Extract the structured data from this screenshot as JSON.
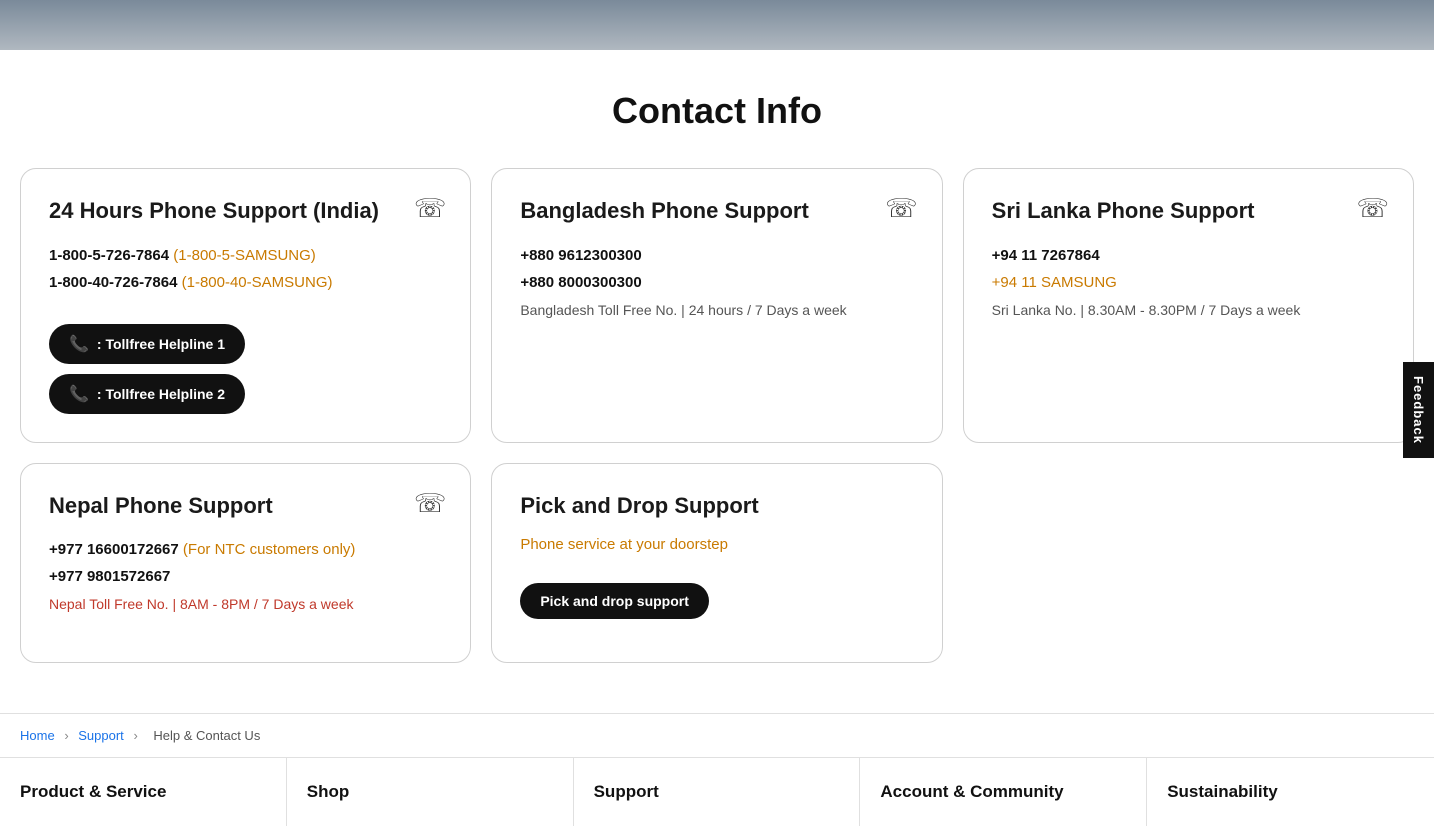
{
  "hero": {},
  "page": {
    "title": "Contact Info"
  },
  "cards_row1": [
    {
      "id": "india",
      "title": "24 Hours Phone Support (India)",
      "phone1": "1-800-5-726-7864",
      "phone1_alt": "(1-800-5-SAMSUNG)",
      "phone2": "1-800-40-726-7864",
      "phone2_alt": "(1-800-40-SAMSUNG)",
      "btn1": "📞 : Tollfree Helpline 1",
      "btn2": "📞 : Tollfree Helpline 2"
    },
    {
      "id": "bangladesh",
      "title": "Bangladesh Phone Support",
      "phone1": "+880 9612300300",
      "phone2": "+880 8000300300",
      "note": "Bangladesh Toll Free No. | 24 hours / 7 Days a week"
    },
    {
      "id": "srilanka",
      "title": "Sri Lanka Phone Support",
      "phone1": "+94 11 7267864",
      "phone2_alt": "+94 11 SAMSUNG",
      "note": "Sri Lanka No. | 8.30AM - 8.30PM / 7 Days a week"
    }
  ],
  "cards_row2": [
    {
      "id": "nepal",
      "title": "Nepal Phone Support",
      "phone1": "+977 16600172667",
      "phone1_alt": "(For NTC customers only)",
      "phone2": "+977 9801572667",
      "note": "Nepal Toll Free No. | 8AM - 8PM / 7 Days a week"
    },
    {
      "id": "pickdrop",
      "title": "Pick and Drop Support",
      "subtitle": "Phone service at your doorstep",
      "btn": "Pick and drop support"
    }
  ],
  "breadcrumb": {
    "home": "Home",
    "support": "Support",
    "current": "Help & Contact Us"
  },
  "footer": {
    "cols": [
      {
        "id": "product-service",
        "label": "Product & Service"
      },
      {
        "id": "shop",
        "label": "Shop"
      },
      {
        "id": "support",
        "label": "Support"
      },
      {
        "id": "account-community",
        "label": "Account & Community"
      },
      {
        "id": "sustainability",
        "label": "Sustainability"
      }
    ]
  },
  "feedback": {
    "label": "Feedback"
  }
}
